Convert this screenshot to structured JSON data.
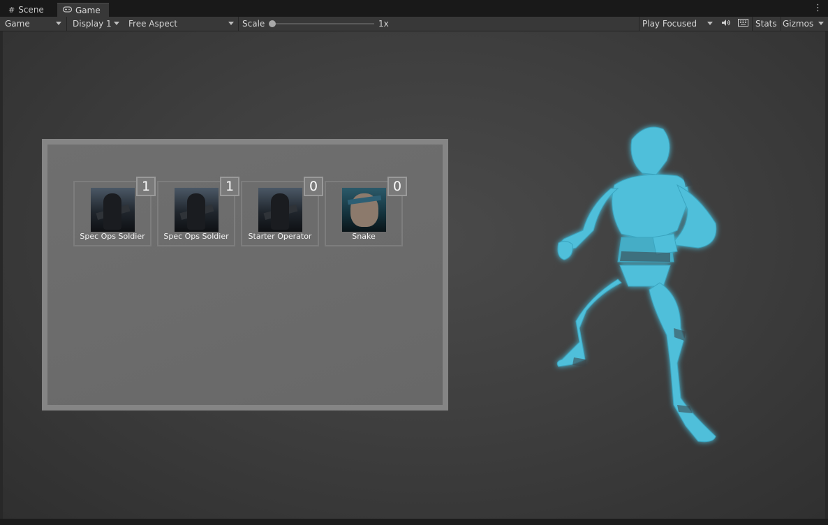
{
  "tabs": [
    {
      "label": "Scene",
      "icon": "grid-icon"
    },
    {
      "label": "Game",
      "icon": "gamepad-icon"
    }
  ],
  "toolbar": {
    "view_mode": "Game",
    "display": "Display 1",
    "aspect": "Free Aspect",
    "scale_label": "Scale",
    "scale_value": "1x",
    "play_mode": "Play Focused",
    "stats_label": "Stats",
    "gizmos_label": "Gizmos"
  },
  "inventory": {
    "slots": [
      {
        "name": "Spec Ops Soldier",
        "count": "1",
        "portrait": "soldier"
      },
      {
        "name": "Spec Ops Soldier",
        "count": "1",
        "portrait": "soldier"
      },
      {
        "name": "Starter Operator",
        "count": "0",
        "portrait": "soldier"
      },
      {
        "name": "Snake",
        "count": "0",
        "portrait": "snake"
      }
    ]
  },
  "colors": {
    "mannequin": "#4fbfda",
    "panel_border": "#858585",
    "panel_fill": "#6b6b6b"
  }
}
